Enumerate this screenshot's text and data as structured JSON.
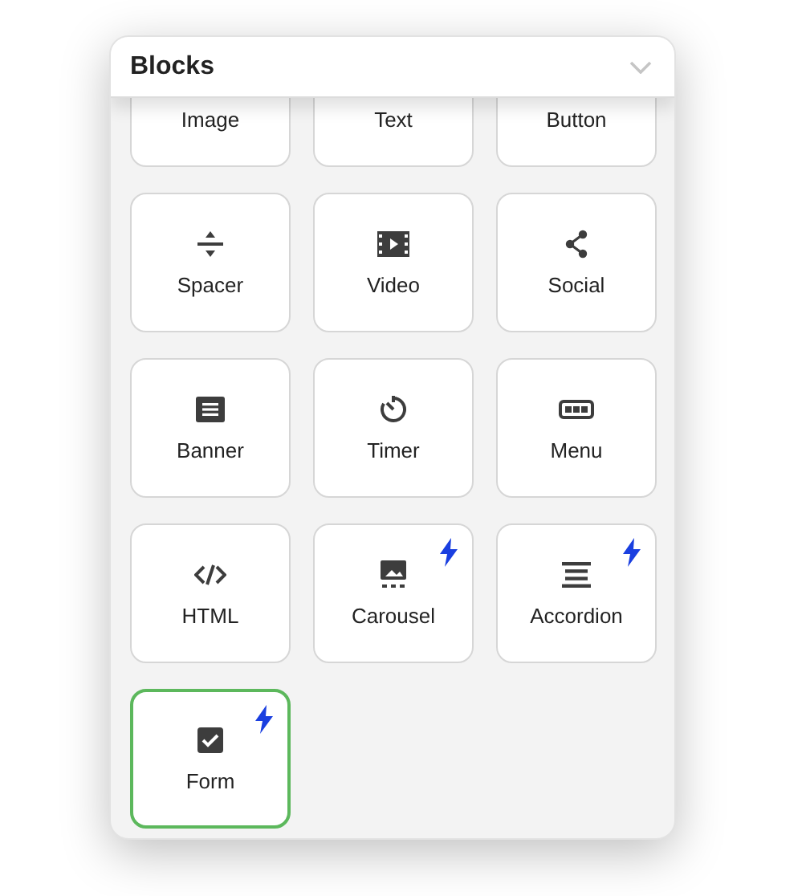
{
  "panel": {
    "title": "Blocks",
    "expanded": true
  },
  "blocks": [
    {
      "label": "Image",
      "premium": false,
      "selected": false
    },
    {
      "label": "Text",
      "premium": false,
      "selected": false
    },
    {
      "label": "Button",
      "premium": false,
      "selected": false
    },
    {
      "label": "Spacer",
      "premium": false,
      "selected": false
    },
    {
      "label": "Video",
      "premium": false,
      "selected": false
    },
    {
      "label": "Social",
      "premium": false,
      "selected": false
    },
    {
      "label": "Banner",
      "premium": false,
      "selected": false
    },
    {
      "label": "Timer",
      "premium": false,
      "selected": false
    },
    {
      "label": "Menu",
      "premium": false,
      "selected": false
    },
    {
      "label": "HTML",
      "premium": false,
      "selected": false
    },
    {
      "label": "Carousel",
      "premium": true,
      "selected": false
    },
    {
      "label": "Accordion",
      "premium": true,
      "selected": false
    },
    {
      "label": "Form",
      "premium": true,
      "selected": true
    }
  ]
}
